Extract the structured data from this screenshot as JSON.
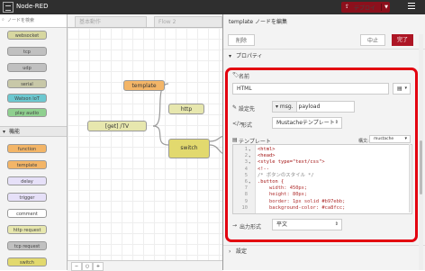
{
  "app": {
    "title": "Node-RED",
    "deploy_label": "デプロイ"
  },
  "palette": {
    "search_placeholder": "ノードを検索",
    "nodes_top": [
      {
        "label": "websocket",
        "color": "#d7d7a0"
      },
      {
        "label": "tcp",
        "color": "#c0c0c0"
      },
      {
        "label": "udp",
        "color": "#c0c0c0"
      },
      {
        "label": "serial",
        "color": "#c8c8a8"
      },
      {
        "label": "Watson IoT",
        "color": "#6cc8d0"
      },
      {
        "label": "play audio",
        "color": "#8fd08f"
      }
    ],
    "category": "機能",
    "nodes_func": [
      {
        "label": "function",
        "color": "#f3b567"
      },
      {
        "label": "template",
        "color": "#f3b567"
      },
      {
        "label": "delay",
        "color": "#e6e0f8"
      },
      {
        "label": "trigger",
        "color": "#e6e0f8"
      },
      {
        "label": "comment",
        "color": "#ffffff"
      },
      {
        "label": "http request",
        "color": "#e7e7ae"
      },
      {
        "label": "tcp request",
        "color": "#c0c0c0"
      },
      {
        "label": "switch",
        "color": "#e2d96e"
      }
    ]
  },
  "workspace": {
    "tabs": [
      "基本動作",
      "Flow 2"
    ],
    "nodes": {
      "template": "template",
      "http": "http",
      "get": "[get] /TV",
      "switch": "switch"
    }
  },
  "tray": {
    "title": "template ノードを編集",
    "delete_label": "削除",
    "cancel_label": "中止",
    "done_label": "完了",
    "properties_label": "プロパティ",
    "name_label": "名前",
    "name_value": "HTML",
    "property_label": "設定先",
    "property_prefix": "msg.",
    "property_value": "payload",
    "format_label": "形式",
    "format_value": "Mustacheテンプレート",
    "template_label": "テンプレート",
    "syntax_label": "構文:",
    "syntax_value": "mustache",
    "output_label": "出力形式",
    "output_value": "平文",
    "settings_label": "設定"
  },
  "code": [
    {
      "n": "1",
      "fold": "▾",
      "text": "<html>"
    },
    {
      "n": "2",
      "fold": "▾",
      "text": "<head>"
    },
    {
      "n": "3",
      "fold": "▾",
      "text": "<style type=\"text/css\">"
    },
    {
      "n": "4",
      "fold": "",
      "text": "<!--"
    },
    {
      "n": "5",
      "fold": "",
      "text": "/* ボタンのスタイル */"
    },
    {
      "n": "6",
      "fold": "▾",
      "text": ".button {"
    },
    {
      "n": "7",
      "fold": "",
      "text": "    width: 450px;"
    },
    {
      "n": "8",
      "fold": "",
      "text": "    height: 80px;"
    },
    {
      "n": "9",
      "fold": "",
      "text": "    border: 1px solid #b97ebb;"
    },
    {
      "n": "10",
      "fold": "",
      "text": "    background-color: #ca8fcc;"
    }
  ]
}
